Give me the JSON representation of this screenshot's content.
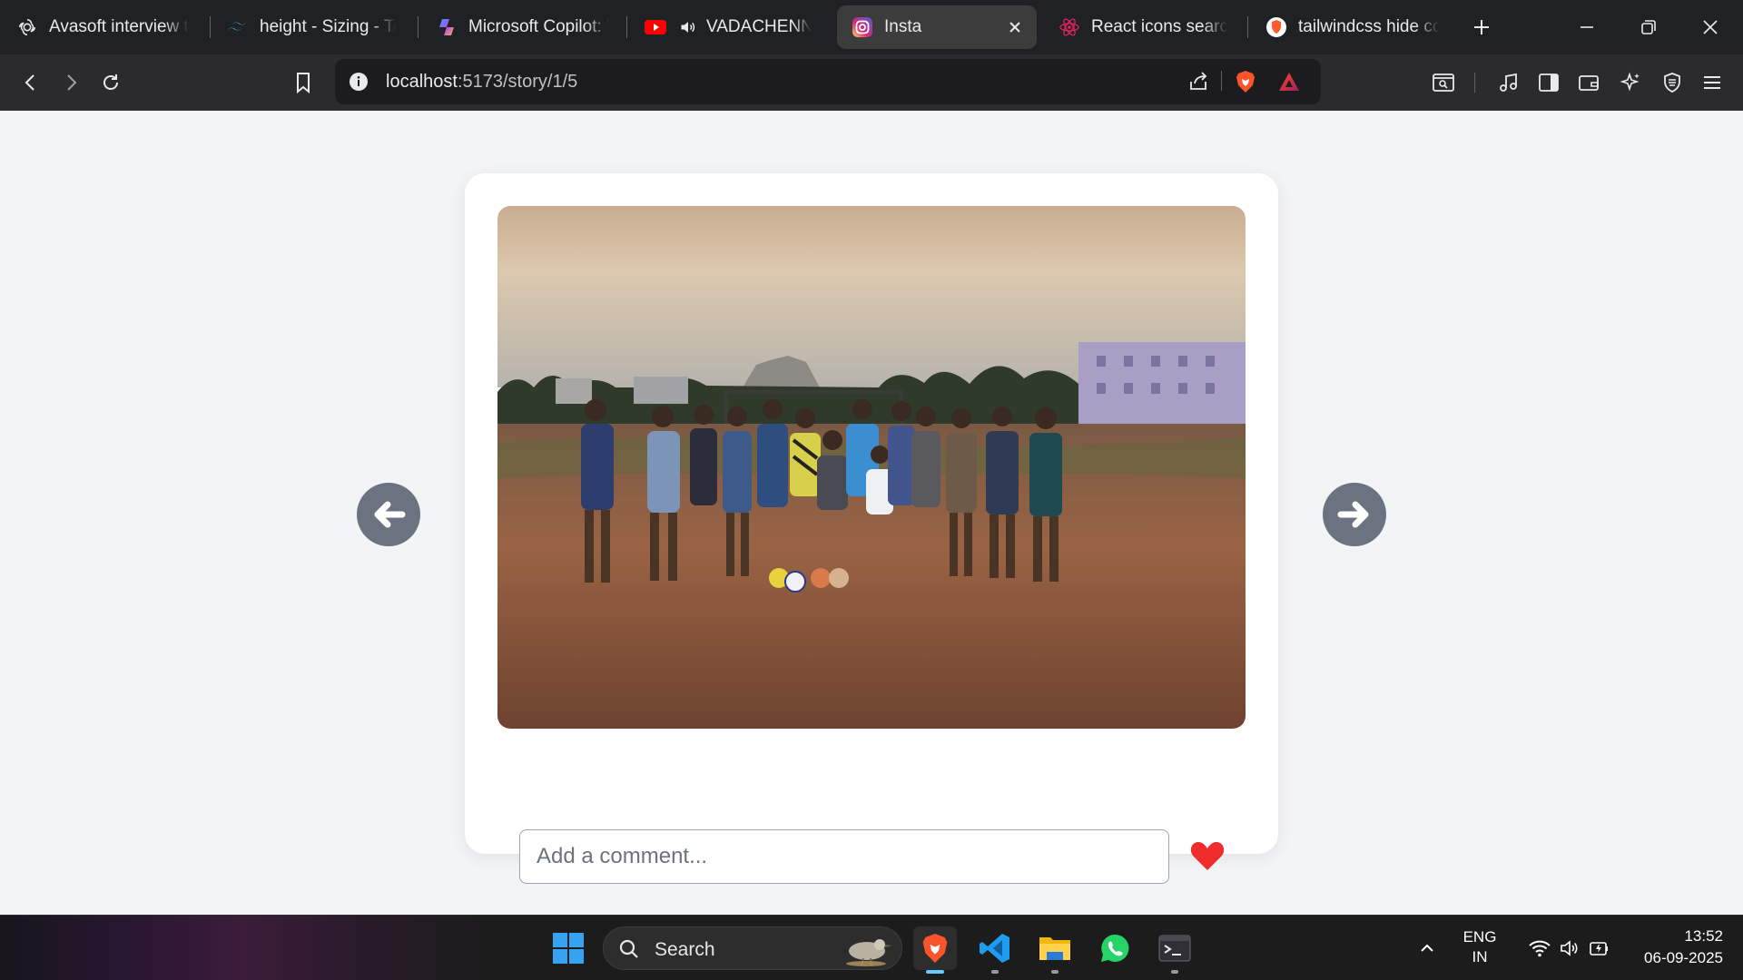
{
  "browser": {
    "tabs": [
      {
        "title": "Avasoft interview tips",
        "icon": "openai-icon"
      },
      {
        "title": "height - Sizing - Tailwind CSS",
        "icon": "tailwind-icon"
      },
      {
        "title": "Microsoft Copilot: Your AI companion",
        "icon": "copilot-icon"
      },
      {
        "title": "VADACHENNAI",
        "icon": "youtube-icon",
        "audio": true
      },
      {
        "title": "Insta",
        "icon": "instagram-icon",
        "active": true
      },
      {
        "title": "React icons search",
        "icon": "react-icon"
      },
      {
        "title": "tailwindcss hide co",
        "icon": "brave-search-icon"
      }
    ],
    "url_host": "localhost",
    "url_path": ":5173/story/1/5"
  },
  "story": {
    "comment_placeholder": "Add a comment...",
    "comment_value": "",
    "photo_desc_icon": "photo-image",
    "colors": {
      "arrow": "#6b7280",
      "heart": "#ef2b2b",
      "card": "#ffffff",
      "page": "#f3f4f6"
    }
  },
  "taskbar": {
    "search_label": "Search",
    "language_line1": "ENG",
    "language_line2": "IN",
    "time": "13:52",
    "date": "06-09-2025"
  }
}
